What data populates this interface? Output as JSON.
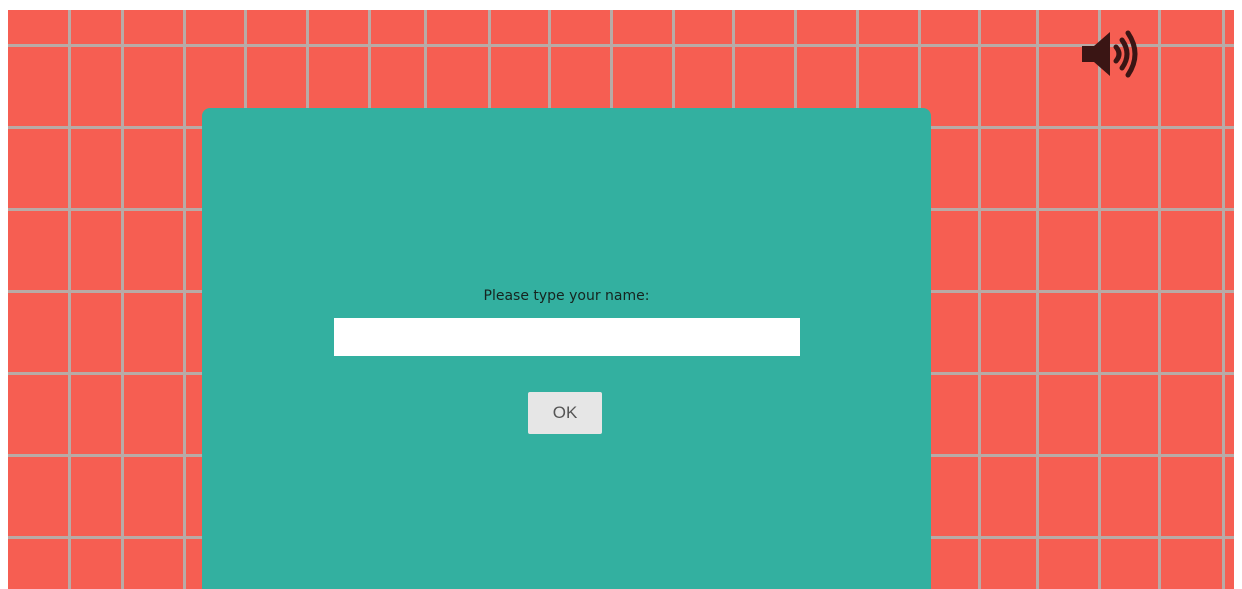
{
  "background": {
    "tile_color": "#f65e52",
    "grid_line_color": "#b9aaa6"
  },
  "sound_toggle": {
    "icon": "speaker-volume-icon",
    "color": "#3a1514"
  },
  "dialog": {
    "background_color": "#33b0a0",
    "prompt": "Please type your name:",
    "name_input_value": "",
    "name_input_placeholder": "",
    "ok_label": "OK"
  }
}
